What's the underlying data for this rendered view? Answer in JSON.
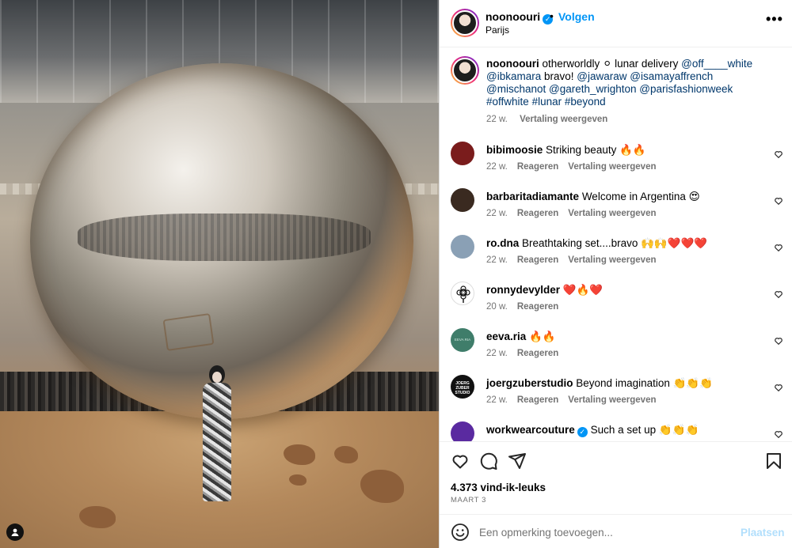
{
  "post": {
    "author": "noonoouri",
    "verified": true,
    "follow_label": "Volgen",
    "separator": "•",
    "location": "Parijs",
    "more_label": "•••"
  },
  "caption": {
    "author": "noonoouri",
    "parts": [
      {
        "text": " otherworldly ⚪ lunar delivery ",
        "tag": false
      },
      {
        "text": "@off____white",
        "tag": true
      },
      {
        "text": " ",
        "tag": false
      },
      {
        "text": "@ibkamara",
        "tag": true
      },
      {
        "text": " bravo! ",
        "tag": false
      },
      {
        "text": "@jawaraw",
        "tag": true
      },
      {
        "text": " ",
        "tag": false
      },
      {
        "text": "@isamayaffrench",
        "tag": true
      },
      {
        "text": " ",
        "tag": false
      },
      {
        "text": "@mischanot",
        "tag": true
      },
      {
        "text": " ",
        "tag": false
      },
      {
        "text": "@gareth_wrighton",
        "tag": true
      },
      {
        "text": " ",
        "tag": false
      },
      {
        "text": "@parisfashionweek",
        "tag": true
      },
      {
        "text": " ",
        "tag": false
      },
      {
        "text": "#offwhite",
        "tag": true
      },
      {
        "text": " ",
        "tag": false
      },
      {
        "text": "#lunar",
        "tag": true
      },
      {
        "text": " ",
        "tag": false
      },
      {
        "text": "#beyond",
        "tag": true
      }
    ],
    "time": "22 w.",
    "translate": "Vertaling weergeven"
  },
  "comments": [
    {
      "user": "bibimoosie",
      "text": "Striking beauty 🔥🔥",
      "time": "22 w.",
      "reply": "Reageren",
      "translate": "Vertaling weergeven",
      "color": "#7a1c1c"
    },
    {
      "user": "barbaritadiamante",
      "text": "Welcome in Argentina 😍",
      "time": "22 w.",
      "reply": "Reageren",
      "translate": "Vertaling weergeven",
      "color": "#3a2a20"
    },
    {
      "user": "ro.dna",
      "text": "Breathtaking set....bravo 🙌🙌❤️❤️❤️",
      "time": "22 w.",
      "reply": "Reageren",
      "translate": "Vertaling weergeven",
      "color": "#8aa0b5"
    },
    {
      "user": "ronnydevylder",
      "text": "❤️🔥❤️",
      "time": "20 w.",
      "reply": "Reageren",
      "translate": "",
      "color": "#ffffff"
    },
    {
      "user": "eeva.ria",
      "text": "🔥🔥",
      "time": "22 w.",
      "reply": "Reageren",
      "translate": "",
      "color": "#3f7d6a"
    },
    {
      "user": "joergzuberstudio",
      "text": "Beyond imagination 👏👏👏",
      "time": "22 w.",
      "reply": "Reageren",
      "translate": "Vertaling weergeven",
      "color": "#111111"
    },
    {
      "user": "workwearcouture",
      "text": "Such a set up 👏👏👏",
      "time": "",
      "reply": "",
      "translate": "",
      "color": "#5a2aa0",
      "verified": true
    }
  ],
  "stats": {
    "likes": "4.373 vind-ik-leuks",
    "date": "MAART 3"
  },
  "composer": {
    "placeholder": "Een opmerking toevoegen...",
    "post_label": "Plaatsen"
  },
  "avatar_badges": {
    "eeva": "EEVA RIA",
    "joerg": "JOERG ZUBER STUDIO"
  }
}
